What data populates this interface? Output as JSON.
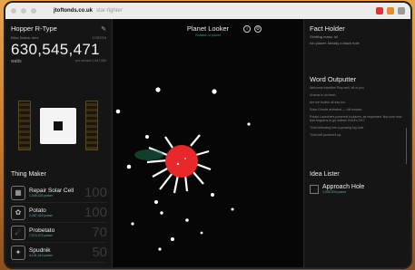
{
  "browser": {
    "host": "jtoftonds.co.uk",
    "path": "star-fighter"
  },
  "ship_panel": {
    "title": "Hopper R-Type",
    "status_label": "Bliss Status: dies",
    "status_value": "17/07/19",
    "power_value": "630,545,471",
    "power_unit": "watts",
    "power_sub": "per second 1,647,080"
  },
  "thing_maker": {
    "title": "Thing Maker",
    "items": [
      {
        "name": "Repair Solar Cell",
        "cost": "1,045,424 power",
        "count": "100",
        "icon": "solar-cell-icon",
        "glyph": "▦"
      },
      {
        "name": "Potato",
        "cost": "2,267,422 power",
        "count": "100",
        "icon": "potato-icon",
        "glyph": "✿"
      },
      {
        "name": "Probetato",
        "cost": "7,074,472 power",
        "count": "70",
        "icon": "probetato-icon",
        "glyph": "☄"
      },
      {
        "name": "Spudnik",
        "cost": "4,141,414 power",
        "count": "50",
        "icon": "spudnik-icon",
        "glyph": "✦"
      }
    ]
  },
  "planet_looker": {
    "title": "Planet Looker",
    "subtitle": "Rotation of planet",
    "info_icon": "info-icon",
    "settings_icon": "gear-icon",
    "planet_color": "#e8282a"
  },
  "fact_holder": {
    "title": "Fact Holder",
    "line1": "Orbiting mass: lol",
    "line2": "Ion planet: literally a black hole"
  },
  "word_outputter": {
    "title": "Word Outputter",
    "lines": [
      "Welcome traveller! Play well, all of you.",
      "Uranus is un-fresh.",
      "Are we foolish all day too.",
      "Solar Cloude activated — full mosaic.",
      "Potato Launchers powered in places, as requested. Not sure how that happens to go indeed. But it's OK?",
      "Torch trillowing into a growing fog hole.",
      "Torch left pushed it up."
    ]
  },
  "idea_lister": {
    "title": "Idea Lister",
    "item_name": "Approach Hole",
    "item_sub": "1,000,000 power"
  },
  "colors": {
    "accent": "#3aa776",
    "planet": "#e8282a"
  }
}
